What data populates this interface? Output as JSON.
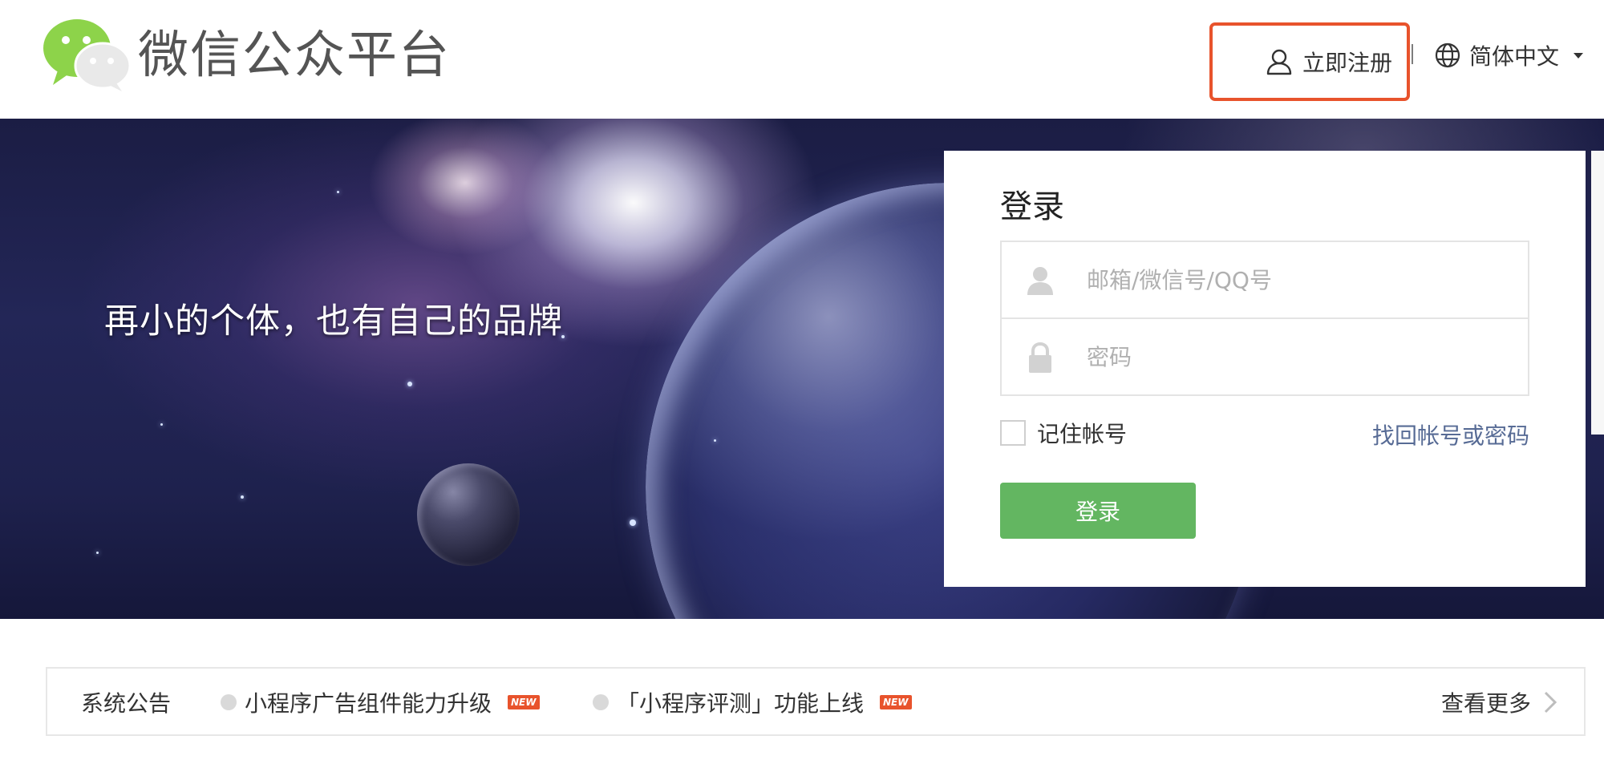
{
  "header": {
    "brand_title": "微信公众平台",
    "register_label": "立即注册",
    "language_label": "简体中文"
  },
  "banner": {
    "slogan": "再小的个体，也有自己的品牌"
  },
  "login": {
    "title": "登录",
    "account_placeholder": "邮箱/微信号/QQ号",
    "password_placeholder": "密码",
    "remember_label": "记住帐号",
    "forgot_label": "找回帐号或密码",
    "submit_label": "登录"
  },
  "notice": {
    "label": "系统公告",
    "items": [
      {
        "text": "小程序广告组件能力升级",
        "badge": "NEW"
      },
      {
        "text": "「小程序评测」功能上线",
        "badge": "NEW"
      }
    ],
    "more_label": "查看更多"
  },
  "colors": {
    "accent_green": "#63b661",
    "highlight_red": "#e8532c",
    "link_blue": "#576b95"
  }
}
